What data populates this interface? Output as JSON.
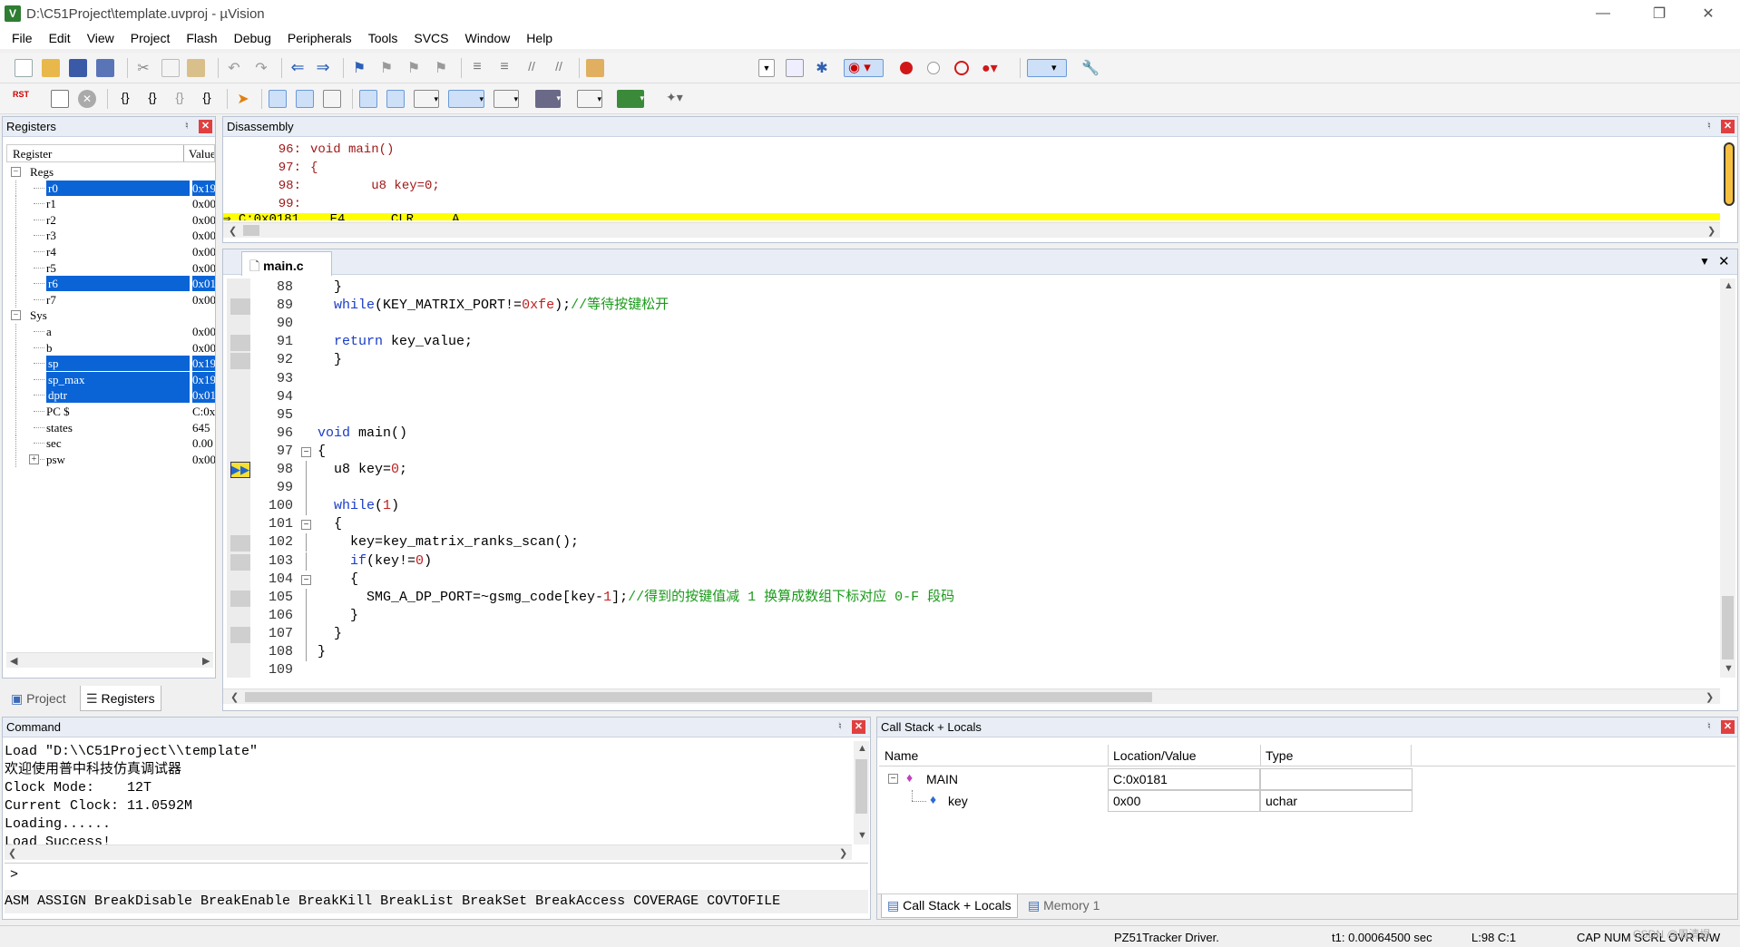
{
  "window": {
    "title": "D:\\C51Project\\template.uvproj - µVision"
  },
  "menu": [
    "File",
    "Edit",
    "View",
    "Project",
    "Flash",
    "Debug",
    "Peripherals",
    "Tools",
    "SVCS",
    "Window",
    "Help"
  ],
  "registers": {
    "title": "Registers",
    "col_register": "Register",
    "col_value": "Value",
    "rows": [
      {
        "name": "Regs",
        "value": "",
        "level": 0,
        "expander": "-",
        "selected": false
      },
      {
        "name": "r0",
        "value": "0x19",
        "level": 2,
        "selected": true
      },
      {
        "name": "r1",
        "value": "0x00",
        "level": 2,
        "selected": false
      },
      {
        "name": "r2",
        "value": "0x00",
        "level": 2,
        "selected": false
      },
      {
        "name": "r3",
        "value": "0x00",
        "level": 2,
        "selected": false
      },
      {
        "name": "r4",
        "value": "0x00",
        "level": 2,
        "selected": false
      },
      {
        "name": "r5",
        "value": "0x00",
        "level": 2,
        "selected": false
      },
      {
        "name": "r6",
        "value": "0x01",
        "level": 2,
        "selected": true
      },
      {
        "name": "r7",
        "value": "0x00",
        "level": 2,
        "selected": false
      },
      {
        "name": "Sys",
        "value": "",
        "level": 0,
        "expander": "-",
        "selected": false
      },
      {
        "name": "a",
        "value": "0x00",
        "level": 2,
        "selected": false
      },
      {
        "name": "b",
        "value": "0x00",
        "level": 2,
        "selected": false
      },
      {
        "name": "sp",
        "value": "0x19",
        "level": 2,
        "selected": true
      },
      {
        "name": "sp_max",
        "value": "0x19",
        "level": 2,
        "selected": true
      },
      {
        "name": "dptr",
        "value": "0x01",
        "level": 2,
        "selected": true
      },
      {
        "name": "PC  $",
        "value": "C:0x",
        "level": 2,
        "selected": false
      },
      {
        "name": "states",
        "value": "645",
        "level": 2,
        "selected": false
      },
      {
        "name": "sec",
        "value": "0.00",
        "level": 2,
        "selected": false
      },
      {
        "name": "psw",
        "value": "0x00",
        "level": 2,
        "expander": "+",
        "selected": false
      }
    ],
    "tabs": [
      "Project",
      "Registers"
    ]
  },
  "disassembly": {
    "title": "Disassembly",
    "lines": [
      {
        "num": "96:",
        "text": "void main()"
      },
      {
        "num": "97:",
        "text": "{"
      },
      {
        "num": "98:",
        "text": "        u8 key=0;"
      },
      {
        "num": "99:",
        "text": ""
      }
    ],
    "current_line_partial": "C:0x0181    E4      CLR     A"
  },
  "editor": {
    "tab": "main.c",
    "lines": [
      {
        "num": "88",
        "marker": false,
        "fold": "",
        "parts": [
          {
            "t": "  }",
            "c": ""
          }
        ]
      },
      {
        "num": "89",
        "marker": true,
        "fold": "",
        "parts": [
          {
            "t": "  ",
            "c": ""
          },
          {
            "t": "while",
            "c": "kw"
          },
          {
            "t": "(KEY_MATRIX_PORT!=",
            "c": ""
          },
          {
            "t": "0xfe",
            "c": "nb"
          },
          {
            "t": ");",
            "c": ""
          },
          {
            "t": "//等待按键松开",
            "c": "cm"
          }
        ]
      },
      {
        "num": "90",
        "marker": false,
        "fold": "",
        "parts": []
      },
      {
        "num": "91",
        "marker": true,
        "fold": "",
        "parts": [
          {
            "t": "  ",
            "c": ""
          },
          {
            "t": "return",
            "c": "kw"
          },
          {
            "t": " key_value;",
            "c": ""
          }
        ]
      },
      {
        "num": "92",
        "marker": true,
        "fold": "",
        "parts": [
          {
            "t": "  }",
            "c": ""
          }
        ]
      },
      {
        "num": "93",
        "marker": false,
        "fold": "",
        "parts": []
      },
      {
        "num": "94",
        "marker": false,
        "fold": "",
        "parts": []
      },
      {
        "num": "95",
        "marker": false,
        "fold": "",
        "parts": []
      },
      {
        "num": "96",
        "marker": false,
        "fold": "",
        "parts": [
          {
            "t": "void",
            "c": "kw"
          },
          {
            "t": " main()",
            "c": ""
          }
        ]
      },
      {
        "num": "97",
        "marker": false,
        "fold": "-",
        "parts": [
          {
            "t": "{",
            "c": ""
          }
        ]
      },
      {
        "num": "98",
        "marker": false,
        "current": true,
        "fold": "",
        "parts": [
          {
            "t": "  u8 key=",
            "c": ""
          },
          {
            "t": "0",
            "c": "nb"
          },
          {
            "t": ";",
            "c": ""
          }
        ]
      },
      {
        "num": "99",
        "marker": false,
        "fold": "",
        "parts": []
      },
      {
        "num": "100",
        "marker": false,
        "fold": "",
        "parts": [
          {
            "t": "  ",
            "c": ""
          },
          {
            "t": "while",
            "c": "kw"
          },
          {
            "t": "(",
            "c": ""
          },
          {
            "t": "1",
            "c": "nb"
          },
          {
            "t": ")",
            "c": ""
          }
        ]
      },
      {
        "num": "101",
        "marker": false,
        "fold": "-",
        "parts": [
          {
            "t": "  {",
            "c": ""
          }
        ]
      },
      {
        "num": "102",
        "marker": true,
        "fold": "",
        "parts": [
          {
            "t": "    key=key_matrix_ranks_scan();",
            "c": ""
          }
        ]
      },
      {
        "num": "103",
        "marker": true,
        "fold": "",
        "parts": [
          {
            "t": "    ",
            "c": ""
          },
          {
            "t": "if",
            "c": "kw"
          },
          {
            "t": "(key!=",
            "c": ""
          },
          {
            "t": "0",
            "c": "nb"
          },
          {
            "t": ")",
            "c": ""
          }
        ]
      },
      {
        "num": "104",
        "marker": false,
        "fold": "-",
        "parts": [
          {
            "t": "    {",
            "c": ""
          }
        ]
      },
      {
        "num": "105",
        "marker": true,
        "fold": "",
        "parts": [
          {
            "t": "      SMG_A_DP_PORT=~gsmg_code[key-",
            "c": ""
          },
          {
            "t": "1",
            "c": "nb"
          },
          {
            "t": "];",
            "c": ""
          },
          {
            "t": "//得到的按键值减 1 换算成数组下标对应 0-F 段码",
            "c": "cm"
          }
        ]
      },
      {
        "num": "106",
        "marker": false,
        "fold": "",
        "parts": [
          {
            "t": "    }",
            "c": ""
          }
        ]
      },
      {
        "num": "107",
        "marker": true,
        "fold": "",
        "parts": [
          {
            "t": "  }",
            "c": ""
          }
        ]
      },
      {
        "num": "108",
        "marker": false,
        "fold": "",
        "parts": [
          {
            "t": "}",
            "c": ""
          }
        ]
      },
      {
        "num": "109",
        "marker": false,
        "fold": "",
        "parts": []
      }
    ]
  },
  "command": {
    "title": "Command",
    "output": [
      "Load \"D:\\\\C51Project\\\\template\"",
      "欢迎使用普中科技仿真调试器",
      "Clock Mode:    12T",
      "Current Clock: 11.0592M",
      "Loading......",
      "Load Success!"
    ],
    "prompt": ">",
    "keywords": "ASM ASSIGN BreakDisable BreakEnable BreakKill BreakList BreakSet BreakAccess COVERAGE COVTOFILE"
  },
  "callstack": {
    "title": "Call Stack + Locals",
    "headers": [
      "Name",
      "Location/Value",
      "Type"
    ],
    "rows": [
      {
        "name": "MAIN",
        "value": "C:0x0181",
        "type": ""
      },
      {
        "name": "key",
        "value": "0x00",
        "type": "uchar"
      }
    ],
    "tabs": [
      "Call Stack + Locals",
      "Memory 1"
    ]
  },
  "status": {
    "driver": "PZ51Tracker Driver.",
    "time": "t1: 0.00064500 sec",
    "pos": "L:98 C:1",
    "caps": "CAP  NUM  SCRL  OVR  R/W",
    "watermark": "CSDN @周清堤"
  },
  "colors": {
    "accent": "#0a64d6",
    "current_line": "#ffff00",
    "comment": "#1a9a1a",
    "keyword": "#1a3cc8",
    "number": "#c02020"
  }
}
